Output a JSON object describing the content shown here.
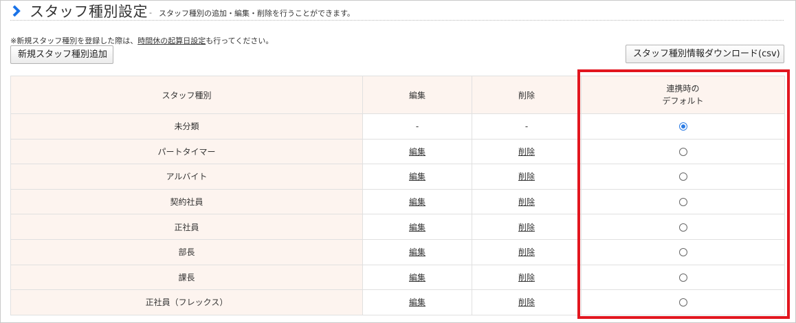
{
  "header": {
    "title": "スタッフ種別設定",
    "separator": "-",
    "subtitle": "スタッフ種別の追加・編集・削除を行うことができます。"
  },
  "note": {
    "prefix": "※新規スタッフ種別を登録した際は、",
    "link": "時間休の起算日設定",
    "suffix": "も行ってください。"
  },
  "buttons": {
    "add": "新規スタッフ種別追加",
    "csv": "スタッフ種別情報ダウンロード(csv)"
  },
  "table": {
    "headers": {
      "type": "スタッフ種別",
      "edit": "編集",
      "delete": "削除",
      "default_line1": "連携時の",
      "default_line2": "デフォルト"
    },
    "rows": [
      {
        "name": "未分類",
        "edit": "-",
        "delete": "-",
        "default": true
      },
      {
        "name": "パートタイマー",
        "edit": "編集",
        "delete": "削除",
        "default": false
      },
      {
        "name": "アルバイト",
        "edit": "編集",
        "delete": "削除",
        "default": false
      },
      {
        "name": "契約社員",
        "edit": "編集",
        "delete": "削除",
        "default": false
      },
      {
        "name": "正社員",
        "edit": "編集",
        "delete": "削除",
        "default": false
      },
      {
        "name": "部長",
        "edit": "編集",
        "delete": "削除",
        "default": false
      },
      {
        "name": "課長",
        "edit": "編集",
        "delete": "削除",
        "default": false
      },
      {
        "name": "正社員（フレックス）",
        "edit": "編集",
        "delete": "削除",
        "default": false
      }
    ]
  },
  "colors": {
    "accent": "#1a73e8",
    "highlight_box": "#e2161f",
    "header_bg": "#fdf4ef"
  },
  "icons": {
    "title_icon": "chevron-right-icon"
  }
}
